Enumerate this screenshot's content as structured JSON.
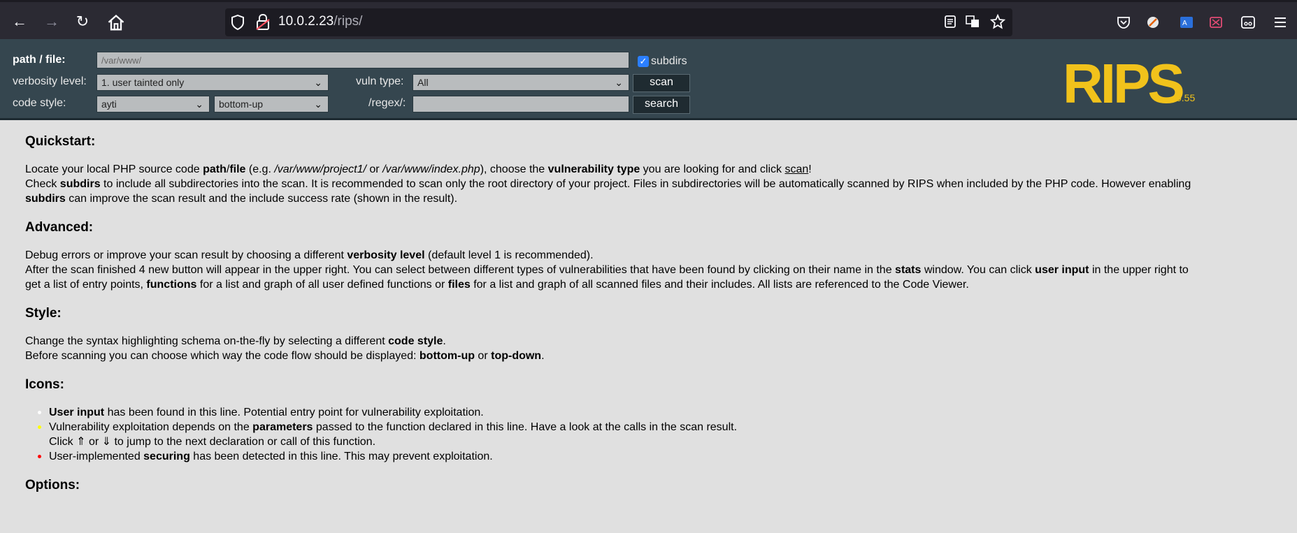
{
  "browser": {
    "url_host": "10.0.2.23",
    "url_path": "/rips/"
  },
  "form": {
    "path_label": "path / file:",
    "path_value": "/var/www/",
    "subdirs_label": "subdirs",
    "subdirs_checked": true,
    "verbosity_label": "verbosity level:",
    "verbosity_value": "1. user tainted only",
    "vuln_label": "vuln type:",
    "vuln_value": "All",
    "scan_label": "scan",
    "code_style_label": "code style:",
    "code_style_value": "ayti",
    "flow_value": "bottom-up",
    "regex_label": "/regex/:",
    "regex_value": "",
    "search_label": "search"
  },
  "logo": {
    "text": "RIPS",
    "version": "0.55",
    "color": "#f1c21b"
  },
  "sections": {
    "quickstart": {
      "title": "Quickstart:",
      "l1a": "Locate your local PHP source code ",
      "l1b": "path",
      "l1c": "/",
      "l1d": "file",
      "l1e": " (e.g. ",
      "l1f": "/var/www/project1/",
      "l1g": " or ",
      "l1h": "/var/www/index.php",
      "l1i": "), choose the ",
      "l1j": "vulnerability type",
      "l1k": " you are looking for and click ",
      "l1l": "scan",
      "l1m": "!",
      "l2a": "Check ",
      "l2b": "subdirs",
      "l2c": " to include all subdirectories into the scan. It is recommended to scan only the root directory of your project. Files in subdirectories will be automatically scanned by RIPS when included by the PHP code. However enabling",
      "l3a": "subdirs",
      "l3b": " can improve the scan result and the include success rate (shown in the result)."
    },
    "advanced": {
      "title": "Advanced:",
      "l1a": "Debug errors or improve your scan result by choosing a different ",
      "l1b": "verbosity level",
      "l1c": " (default level 1 is recommended).",
      "l2a": "After the scan finished 4 new button will appear in the upper right. You can select between different types of vulnerabilities that have been found by clicking on their name in the ",
      "l2b": "stats",
      "l2c": " window. You can click ",
      "l2d": "user input",
      "l2e": " in the upper right to",
      "l3a": "get a list of entry points, ",
      "l3b": "functions",
      "l3c": " for a list and graph of all user defined functions or ",
      "l3d": "files",
      "l3e": " for a list and graph of all scanned files and their includes. All lists are referenced to the Code Viewer."
    },
    "style": {
      "title": "Style:",
      "l1a": "Change the syntax highlighting schema on-the-fly by selecting a different ",
      "l1b": "code style",
      "l1c": ".",
      "l2a": "Before scanning you can choose which way the code flow should be displayed: ",
      "l2b": "bottom-up",
      "l2c": " or ",
      "l2d": "top-down",
      "l2e": "."
    },
    "icons": {
      "title": "Icons:",
      "i1a": "User input",
      "i1b": " has been found in this line. Potential entry point for vulnerability exploitation.",
      "i1_color": "#ffffff",
      "i2a": "Vulnerability exploitation depends on the ",
      "i2b": "parameters",
      "i2c": " passed to the function declared in this line. Have a look at the calls in the scan result.",
      "i2d": "Click ⇑ or ⇓ to jump to the next declaration or call of this function.",
      "i2_color": "#ffff00",
      "i3a": "User-implemented ",
      "i3b": "securing",
      "i3c": " has been detected in this line. This may prevent exploitation.",
      "i3_color": "#ff0000"
    },
    "options": {
      "title": "Options:"
    }
  }
}
